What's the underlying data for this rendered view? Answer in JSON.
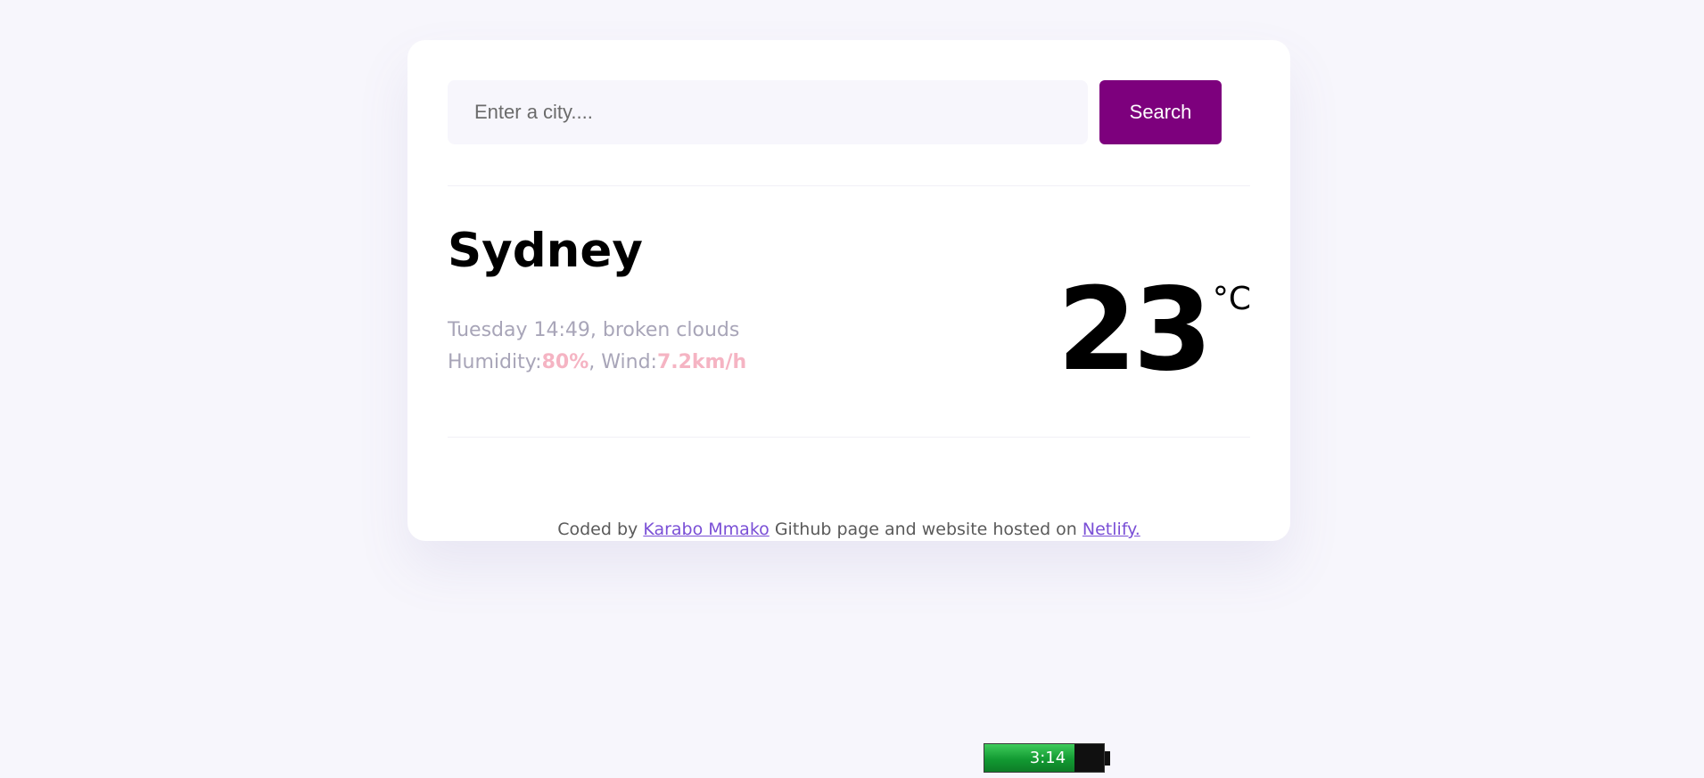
{
  "search": {
    "placeholder": "Enter a city....",
    "value": "",
    "button_label": "Search"
  },
  "weather": {
    "city": "Sydney",
    "date_description": "Tuesday 14:49, broken clouds",
    "humidity_label": "Humidity:",
    "humidity_value": "80%",
    "separator": ", ",
    "wind_label": "Wind:",
    "wind_value": "7.2km/h",
    "temperature": "23",
    "unit": "°C"
  },
  "footer": {
    "prefix": "Coded by ",
    "author_link": "Karabo Mmako",
    "middle": " Github page and website hosted on ",
    "host_link": "Netlify."
  },
  "battery": {
    "time": "3:14",
    "level": 0.75
  },
  "colors": {
    "accent": "#7d007d",
    "highlight": "#f5b4c3",
    "link": "#7a4fd6",
    "background": "#f7f6fc"
  }
}
